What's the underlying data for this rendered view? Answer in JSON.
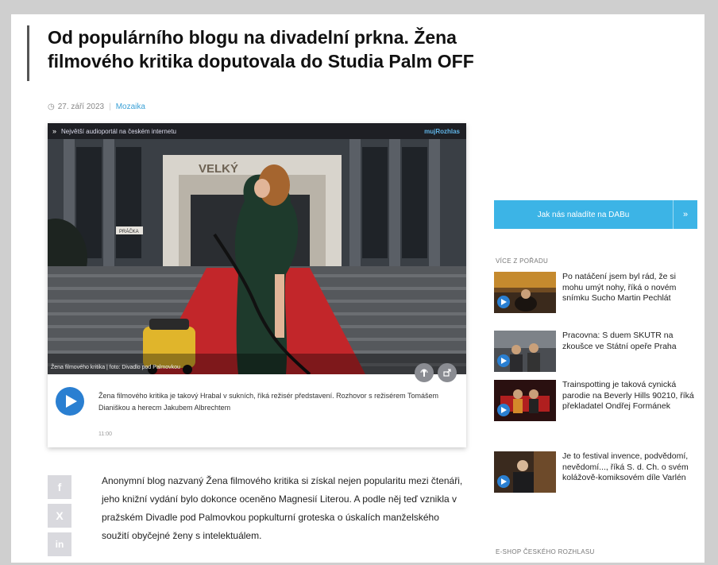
{
  "article": {
    "title": "Od populárního blogu na divadelní prkna. Žena filmového kritika doputovala do Studia Palm OFF",
    "date": "27. září 2023",
    "category": "Mozaika"
  },
  "player": {
    "top_label": "Největší audioportál na českém internetu",
    "brand": "mujRozhlas",
    "photo_caption": "Žena filmového kritika | foto: Divadlo pod Palmovkou",
    "photo_sign": "VELKÝ",
    "photo_door_sign": "PRÁČKA",
    "description": "Žena filmového kritika je takový Hrabal v sukních, říká režisér představení. Rozhovor s režisérem Tomášem Dianiškou a herecm Jakubem Albrechtem",
    "duration": "11:00"
  },
  "share": {
    "facebook": "f",
    "x": "X",
    "linkedin": "in"
  },
  "body_text": "Anonymní blog nazvaný Žena filmového kritika si získal nejen popularitu mezi čtenáři, jeho knižní vydání bylo dokonce oceněno Magnesií Literou. A podle něj teď vznikla v pražském Divadle pod Palmovkou popkulturní groteska o úskalích manželského soužití obyčejné ženy s intelektuálem.",
  "sidebar": {
    "dab_label": "Jak nás naladíte na DABu",
    "dab_arrow": "»",
    "more_heading": "VÍCE Z POŘADU",
    "eshop_heading": "E-SHOP ČESKÉHO ROZHLASU",
    "items": [
      {
        "text": "Po natáčení jsem byl rád, že si mohu umýt nohy, říká o novém snímku Sucho Martin Pechlát"
      },
      {
        "text": "Pracovna: S duem SKUTR na zkoušce ve Státní opeře Praha"
      },
      {
        "text": "Trainspotting je taková cynická parodie na Beverly Hills 90210, říká překladatel Ondřej Formánek"
      },
      {
        "text": "Je to festival invence, podvědomí, nevědomí..., říká S. d. Ch. o svém kolážově-komiksovém díle Varlén"
      }
    ]
  },
  "colors": {
    "accent": "#3cb4e6",
    "play": "#2a7fd1"
  }
}
